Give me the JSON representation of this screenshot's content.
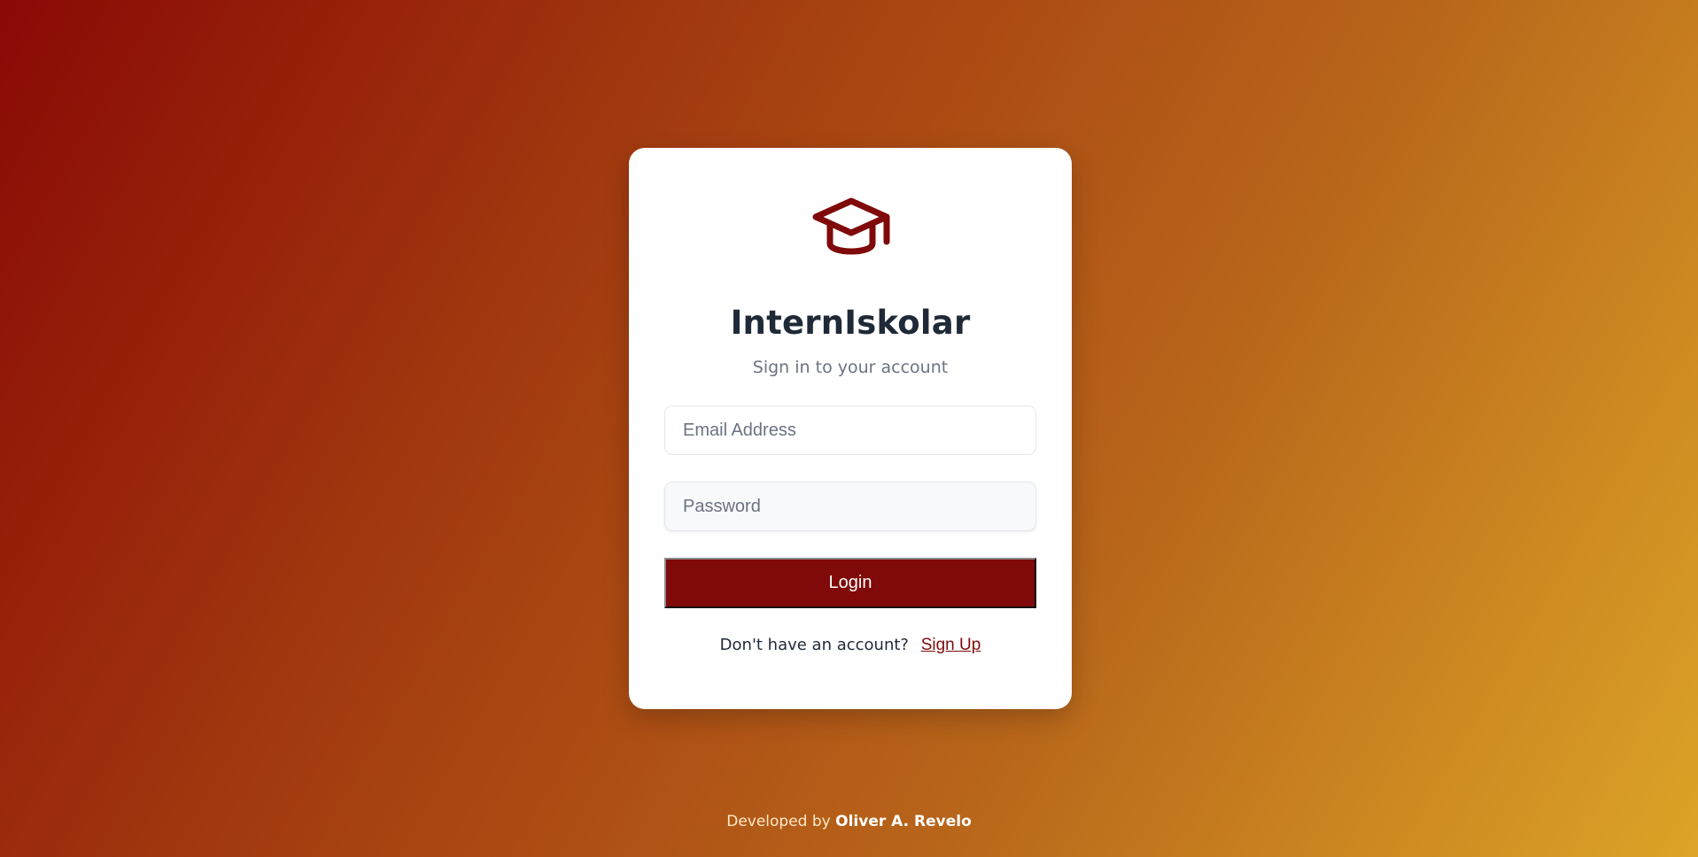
{
  "logo": {
    "icon": "graduation-cap-icon",
    "color": "#7f0a09"
  },
  "app": {
    "title": "InternIskolar",
    "subtitle": "Sign in to your account"
  },
  "form": {
    "email_placeholder": "Email Address",
    "email_value": "",
    "password_placeholder": "Password",
    "password_value": "",
    "login_label": "Login"
  },
  "signup": {
    "prompt": "Don't have an account?",
    "link_label": "Sign Up"
  },
  "footer": {
    "prefix": "Developed by",
    "author": "Oliver A. Revelo"
  },
  "colors": {
    "accent": "#7f0a09",
    "gradient_start": "#8a0a05",
    "gradient_end": "#dca427"
  }
}
